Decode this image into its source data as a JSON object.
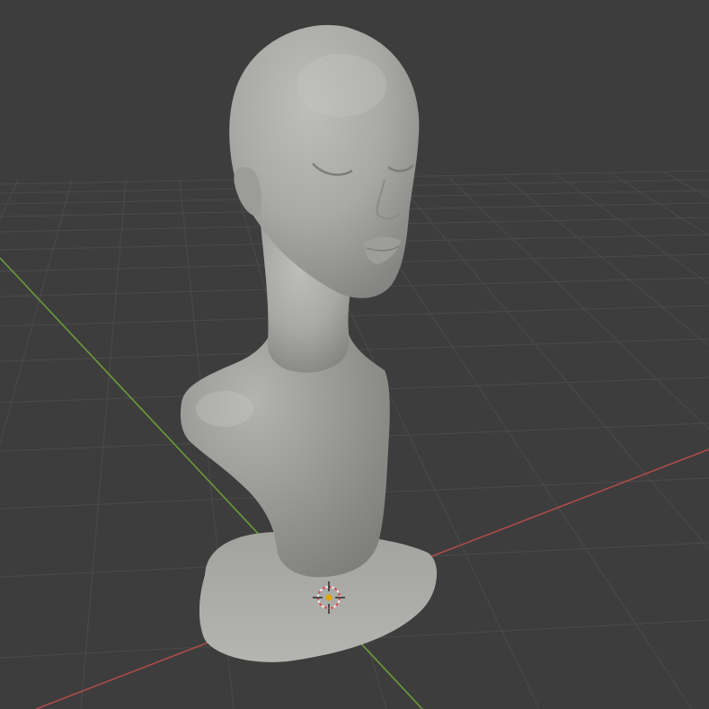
{
  "viewport": {
    "mode": "solid-shading",
    "background_color": "#3d3d3d",
    "grid": true,
    "grid_color": "#4a4a4a",
    "x_axis_color": "#b04a4a",
    "y_axis_color": "#6e9a3a"
  },
  "scene": {
    "object": {
      "type": "sculpted-bust",
      "material_color": "#a9aaa6"
    },
    "cursor_3d": {
      "icon": "3d-cursor-icon",
      "ring_color": "#d94c4c",
      "center_color": "#e0a400"
    }
  }
}
